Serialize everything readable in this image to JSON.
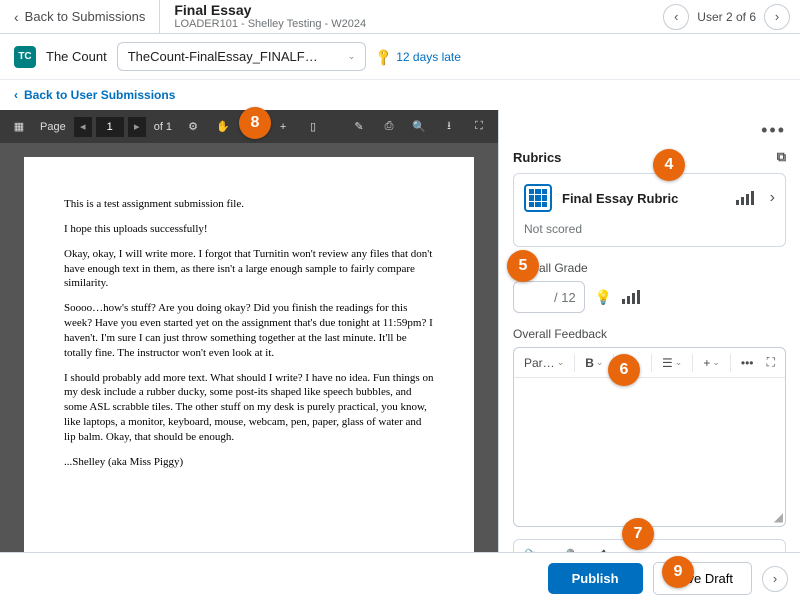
{
  "header": {
    "back_label": "Back to Submissions",
    "title": "Final Essay",
    "subtitle": "LOADER101 - Shelley Testing - W2024",
    "user_counter": "User 2 of 6"
  },
  "subheader": {
    "avatar_initials": "TC",
    "username": "The Count",
    "file_name": "TheCount-FinalEssay_FINALF…",
    "late_text": "12 days late"
  },
  "back_user_label": "Back to User Submissions",
  "doc_toolbar": {
    "page_label": "Page",
    "page_current": "1",
    "page_total": "of 1"
  },
  "document": {
    "p1": "This is a test assignment submission file.",
    "p2": "I hope this uploads successfully!",
    "p3": "Okay, okay, I will write more. I forgot that Turnitin won't review any files that don't have enough text in them, as there isn't a large enough sample to fairly compare similarity.",
    "p4": "Soooo…how's stuff? Are you doing okay? Did you finish the readings for this week? Have you even started yet on the assignment that's due tonight at 11:59pm? I haven't. I'm sure I can just throw something together at the last minute. It'll be totally fine. The instructor won't even look at it.",
    "p5": "I should probably add more text. What should I write? I have no idea. Fun things on my desk include a rubber ducky, some post-its shaped like speech bubbles, and some ASL scrabble tiles. The other stuff on my desk is purely practical, you know, like laptops, a monitor, keyboard, mouse, webcam, pen, paper, glass of water and lip balm. Okay, that should be enough.",
    "p6": "...Shelley (aka Miss Piggy)"
  },
  "right": {
    "rubrics_label": "Rubrics",
    "rubric_name": "Final Essay Rubric",
    "not_scored": "Not scored",
    "overall_grade_label": "Overall Grade",
    "grade_max": "/ 12",
    "overall_feedback_label": "Overall Feedback",
    "editor_para": "Par…"
  },
  "footer": {
    "publish": "Publish",
    "save_draft": "Save Draft"
  },
  "callouts": {
    "c4": "4",
    "c5": "5",
    "c6": "6",
    "c7": "7",
    "c8": "8",
    "c9": "9"
  }
}
